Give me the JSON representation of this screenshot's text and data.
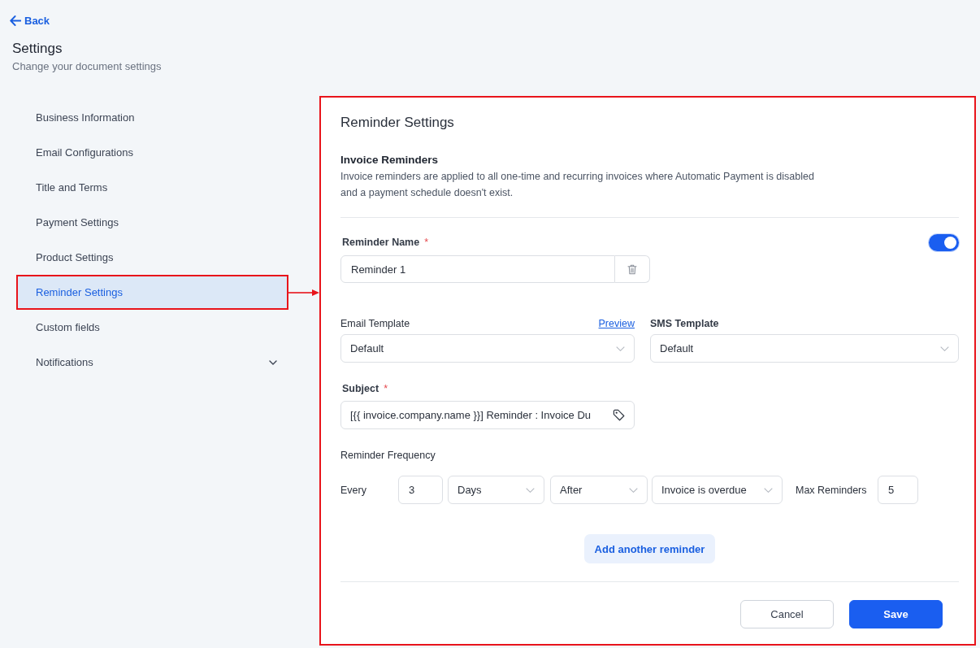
{
  "back_link": {
    "label": "Back"
  },
  "header": {
    "title": "Settings",
    "subtitle": "Change your document settings"
  },
  "sidebar": {
    "items": [
      {
        "label": "Business Information",
        "kind": "link",
        "selected": false
      },
      {
        "label": "Email Configurations",
        "kind": "link",
        "selected": false
      },
      {
        "label": "Title and Terms",
        "kind": "link",
        "selected": false
      },
      {
        "label": "Payment Settings",
        "kind": "link",
        "selected": false
      },
      {
        "label": "Product Settings",
        "kind": "link",
        "selected": false
      },
      {
        "label": "Reminder Settings",
        "kind": "link",
        "selected": true
      },
      {
        "label": "Custom fields",
        "kind": "link",
        "selected": false
      },
      {
        "label": "Notifications",
        "kind": "group",
        "selected": false
      }
    ]
  },
  "highlight_callout": true,
  "panel": {
    "title": "Reminder Settings",
    "section": {
      "title": "Invoice Reminders",
      "description": "Invoice reminders are applied to all one-time and recurring invoices where Automatic Payment is disabled and a payment schedule doesn't exist."
    },
    "reminder": {
      "name_field": {
        "label": "Reminder Name",
        "required_mark": "*",
        "value": "Reminder 1"
      },
      "enabled": true,
      "email_template": {
        "label": "Email Template",
        "link": "Preview",
        "value": "Default"
      },
      "sms_template": {
        "label": "SMS Template",
        "value": "Default"
      },
      "subject": {
        "label": "Subject",
        "required_mark": "*",
        "value": "[{{ invoice.company.name }}] Reminder : Invoice Du"
      },
      "frequency": {
        "label": "Reminder Frequency",
        "prefix": "Every",
        "interval": "3",
        "unit": "Days",
        "relation": "After",
        "event": "Invoice is overdue",
        "max_label": "Max Reminders",
        "max_value": "5"
      }
    },
    "add_button": "Add another reminder",
    "buttons": [
      {
        "label": "Cancel",
        "kind": "secondary"
      },
      {
        "label": "Save",
        "kind": "primary"
      }
    ]
  }
}
